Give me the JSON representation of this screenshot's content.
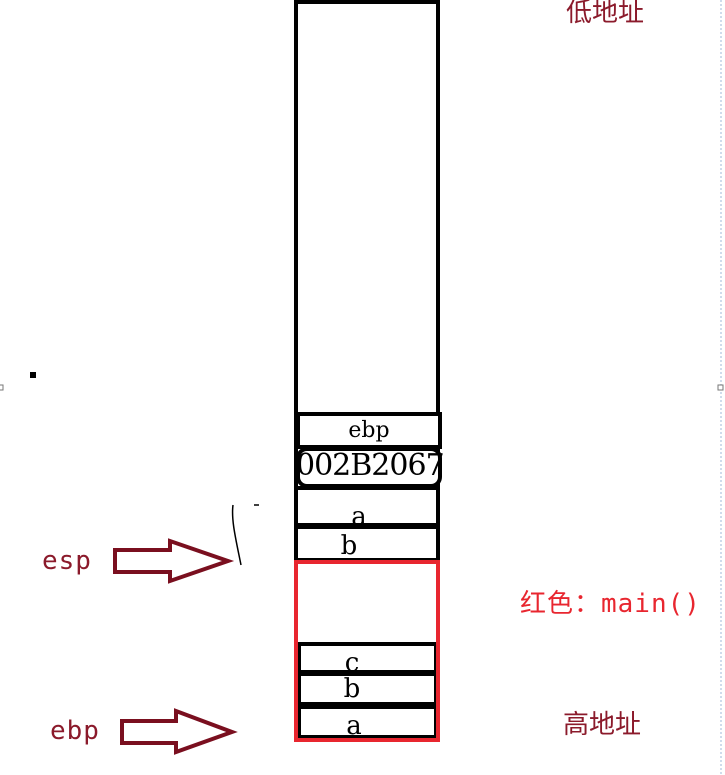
{
  "labels": {
    "low_address": "低地址",
    "high_address": "高地址",
    "red_legend": "红色：main()",
    "esp": "esp",
    "ebp": "ebp"
  },
  "stack_cells": {
    "saved_ebp": "ebp",
    "return_address": "002B2067",
    "param_a": "a",
    "param_b": "b"
  },
  "main_frame_cells": {
    "c": "c",
    "b": "b",
    "a": "a"
  },
  "colors": {
    "label": "#8b1a2b",
    "arrow": "#7a0f1f",
    "main_frame": "#e8262f",
    "stack": "#000000"
  }
}
